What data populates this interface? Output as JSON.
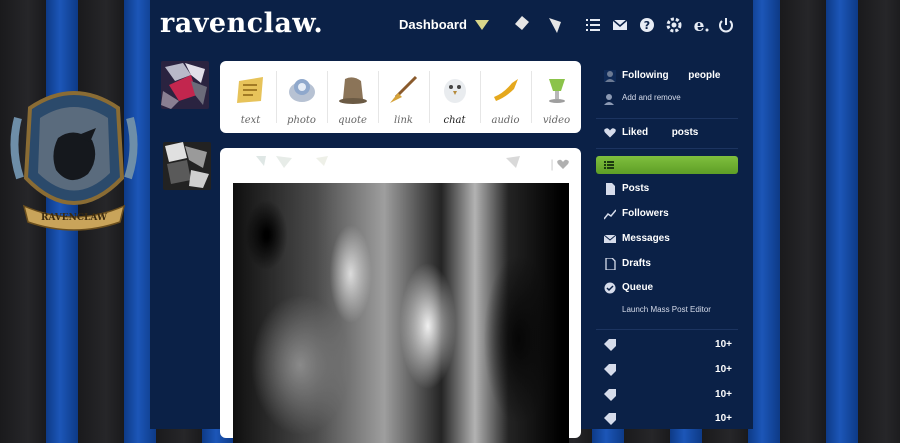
{
  "header": {
    "logo_text": "ravenclaw.",
    "nav": {
      "dashboard_label": "Dashboard",
      "icons": [
        "dashboard-arrow-icon",
        "mail-icon",
        "help-icon",
        "settings-icon",
        "e-icon",
        "power-icon",
        "list-icon"
      ]
    }
  },
  "crest": {
    "banner_text": "RAVENCLAW"
  },
  "composer": {
    "post_types": [
      {
        "label": "text"
      },
      {
        "label": "photo"
      },
      {
        "label": "quote"
      },
      {
        "label": "link"
      },
      {
        "label": "chat"
      },
      {
        "label": "audio"
      },
      {
        "label": "video"
      }
    ]
  },
  "post": {
    "like_icon": "heart-icon"
  },
  "sidebar": {
    "following_label": "Following",
    "following_suffix": "people",
    "add_remove_label": "Add and remove",
    "liked_label": "Liked",
    "liked_suffix": "posts",
    "menu": [
      {
        "label": "Posts"
      },
      {
        "label": "Followers"
      },
      {
        "label": "Messages"
      },
      {
        "label": "Drafts"
      },
      {
        "label": "Queue"
      },
      {
        "label": "Launch Mass Post Editor"
      }
    ],
    "tag_counts": [
      "10+",
      "10+",
      "10+",
      "10+"
    ]
  },
  "colors": {
    "header_bg": "#0b2147",
    "active_green": "#6fae2e",
    "stripe_blue": "#1c56b8"
  }
}
